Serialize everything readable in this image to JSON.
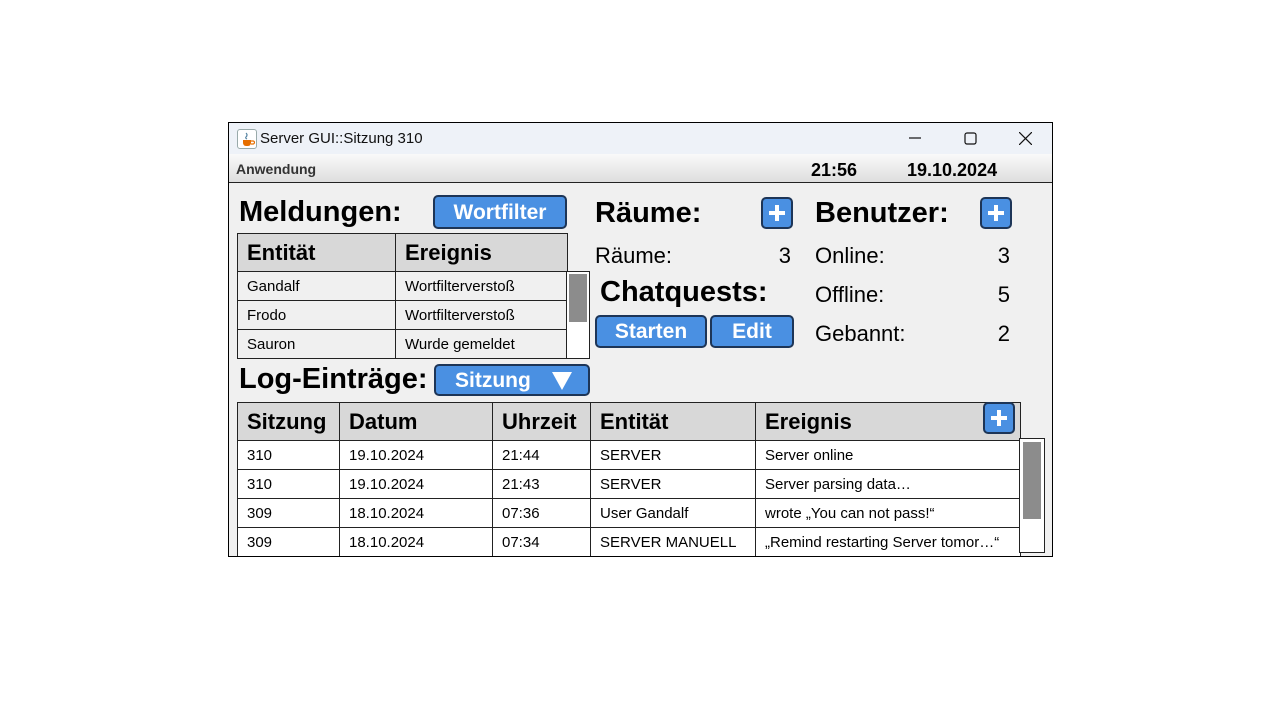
{
  "window": {
    "title": "Server GUI::Sitzung 310"
  },
  "menubar": {
    "app_menu": "Anwendung",
    "time": "21:56",
    "date": "19.10.2024"
  },
  "meldungen": {
    "heading": "Meldungen:",
    "filter_button": "Wortfilter",
    "columns": [
      "Entität",
      "Ereignis"
    ],
    "rows": [
      [
        "Gandalf",
        "Wortfilterverstoß"
      ],
      [
        "Frodo",
        "Wortfilterverstoß"
      ],
      [
        "Sauron",
        "Wurde gemeldet"
      ]
    ]
  },
  "raeume": {
    "heading": "Räume:",
    "count_label": "Räume:",
    "count": "3"
  },
  "chatquests": {
    "heading": "Chatquests:",
    "start_button": "Starten",
    "edit_button": "Edit"
  },
  "benutzer": {
    "heading": "Benutzer:",
    "stats": [
      {
        "label": "Online:",
        "value": "3"
      },
      {
        "label": "Offline:",
        "value": "5"
      },
      {
        "label": "Gebannt:",
        "value": "2"
      }
    ]
  },
  "log": {
    "heading": "Log-Einträge:",
    "filter_select": "Sitzung",
    "columns": [
      "Sitzung",
      "Datum",
      "Uhrzeit",
      "Entität",
      "Ereignis"
    ],
    "rows": [
      [
        "310",
        "19.10.2024",
        "21:44",
        "SERVER",
        "Server online"
      ],
      [
        "310",
        "19.10.2024",
        "21:43",
        "SERVER",
        "Server parsing data…"
      ],
      [
        "309",
        "18.10.2024",
        "07:36",
        "User Gandalf",
        "wrote „You can not pass!“"
      ],
      [
        "309",
        "18.10.2024",
        "07:34",
        "SERVER MANUELL",
        "„Remind restarting Server tomor…“"
      ]
    ]
  },
  "icons": {
    "app": "java-cup-icon",
    "minimize": "minimize-icon",
    "maximize": "maximize-icon",
    "close": "close-icon",
    "add": "plus-icon",
    "dropdown": "triangle-down-icon"
  },
  "colors": {
    "accent": "#4a90e2",
    "button_border": "#1d3557",
    "window_bg": "#f0f0f0",
    "header_bg": "#d8d8d8"
  }
}
